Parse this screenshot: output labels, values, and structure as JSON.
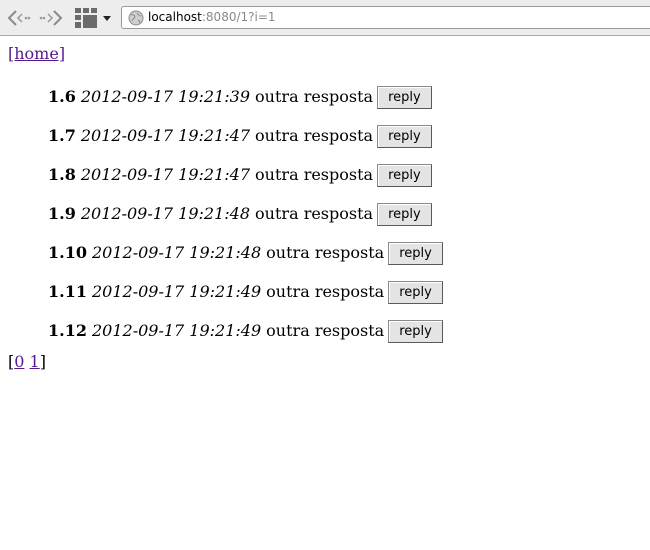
{
  "browser": {
    "url_host": "localhost",
    "url_rest": ":8080/1?i=1"
  },
  "nav": {
    "home_label": "[home]"
  },
  "replies": [
    {
      "num": "1.6",
      "timestamp": "2012-09-17 19:21:39",
      "text": "outra resposta",
      "button": "reply"
    },
    {
      "num": "1.7",
      "timestamp": "2012-09-17 19:21:47",
      "text": "outra resposta",
      "button": "reply"
    },
    {
      "num": "1.8",
      "timestamp": "2012-09-17 19:21:47",
      "text": "outra resposta",
      "button": "reply"
    },
    {
      "num": "1.9",
      "timestamp": "2012-09-17 19:21:48",
      "text": "outra resposta",
      "button": "reply"
    },
    {
      "num": "1.10",
      "timestamp": "2012-09-17 19:21:48",
      "text": "outra resposta",
      "button": "reply"
    },
    {
      "num": "1.11",
      "timestamp": "2012-09-17 19:21:49",
      "text": "outra resposta",
      "button": "reply"
    },
    {
      "num": "1.12",
      "timestamp": "2012-09-17 19:21:49",
      "text": "outra resposta",
      "button": "reply"
    }
  ],
  "pager": {
    "open": "[",
    "pages": [
      "0",
      "1"
    ],
    "close": "]"
  }
}
